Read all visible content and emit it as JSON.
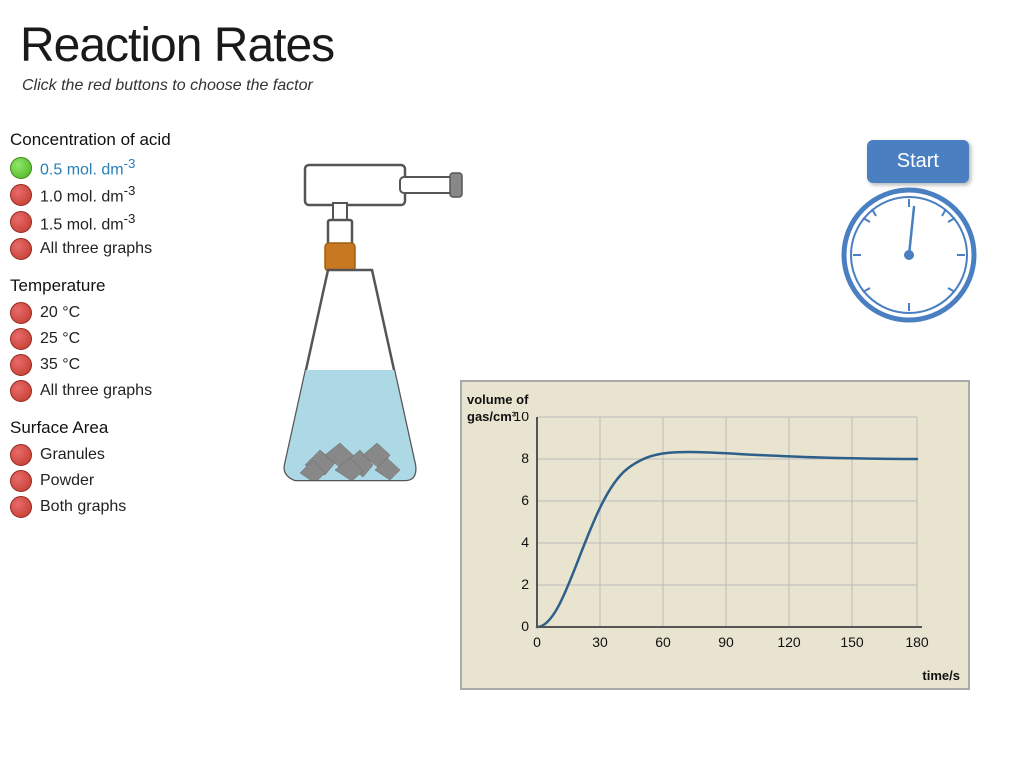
{
  "title": "Reaction Rates",
  "subtitle": "Click the red buttons to choose the factor",
  "sections": {
    "concentration": {
      "title": "Concentration of acid",
      "options": [
        {
          "label": "0.5 mol. dm⁻³",
          "active": true,
          "dot": "green"
        },
        {
          "label": "1.0 mol. dm⁻³",
          "active": false,
          "dot": "red"
        },
        {
          "label": "1.5 mol. dm⁻³",
          "active": false,
          "dot": "red"
        },
        {
          "label": "All three graphs",
          "active": false,
          "dot": "red"
        }
      ]
    },
    "temperature": {
      "title": "Temperature",
      "options": [
        {
          "label": "20  °C",
          "active": false,
          "dot": "red"
        },
        {
          "label": "25  °C",
          "active": false,
          "dot": "red"
        },
        {
          "label": "35  °C",
          "active": false,
          "dot": "red"
        },
        {
          "label": "All three graphs",
          "active": false,
          "dot": "red"
        }
      ]
    },
    "surface": {
      "title": "Surface Area",
      "options": [
        {
          "label": "Granules",
          "active": false,
          "dot": "red"
        },
        {
          "label": "Powder",
          "active": false,
          "dot": "red"
        },
        {
          "label": "Both graphs",
          "active": false,
          "dot": "red"
        }
      ]
    }
  },
  "graph": {
    "y_label": "volume of\ngas/cm³",
    "x_label": "time/s",
    "y_ticks": [
      0,
      2,
      4,
      6,
      8,
      10
    ],
    "x_ticks": [
      0,
      30,
      60,
      90,
      120,
      150,
      180
    ]
  },
  "start_button": "Start",
  "colors": {
    "start_button": "#4a7fc1",
    "active_text": "#2980b9",
    "graph_bg": "#e8e4d0"
  }
}
